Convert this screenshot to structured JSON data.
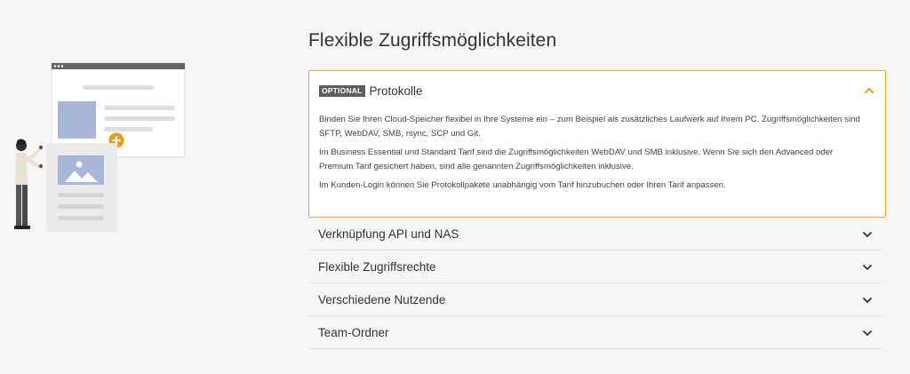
{
  "section": {
    "title": "Flexible Zugriffsmöglichkeiten"
  },
  "open_item": {
    "badge": "OPTIONAL",
    "title": "Protokolle",
    "paragraphs": [
      "Binden Sie Ihren Cloud-Speicher flexibel in Ihre Systeme ein – zum Beispiel als zusätzliches Laufwerk auf Ihrem PC. Zugriffs­möglichkeiten sind SFTP, WebDAV, SMB, rsync, SCP und Git.",
      "Im Business Essential und Standard Tarif sind die Zugriffsmöglichkeiten WebDAV und SMB inklusive. Wenn Sie sich den Advan­ced oder Premium Tarif gesichert haben, sind alle genannten Zugriffsmöglichkeiten inklusive.",
      "Im Kunden-Login können Sie Protokollpakete unabhängig vom Tarif hinzubuchen oder Ihren Tarif anpassen."
    ]
  },
  "items": [
    {
      "title": "Verknüpfung API und NAS"
    },
    {
      "title": "Flexible Zugriffsrechte"
    },
    {
      "title": "Verschiedene Nutzende"
    },
    {
      "title": "Team-Ordner"
    }
  ],
  "colors": {
    "accent": "#f3a53a",
    "background": "#f6f6f6",
    "badge": "#5d5d5d"
  },
  "icons": {
    "expanded": "chevron-up-icon",
    "collapsed": "chevron-down-icon"
  }
}
